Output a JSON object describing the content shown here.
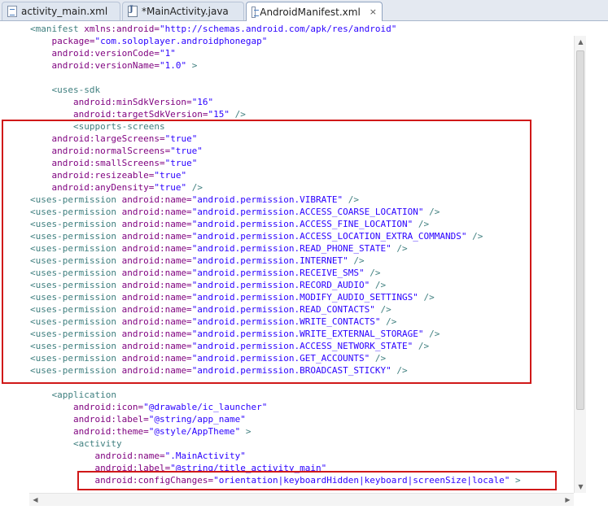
{
  "tabs": [
    {
      "label": "activity_main.xml",
      "icon": "xml-file-icon",
      "active": false
    },
    {
      "label": "*MainActivity.java",
      "icon": "java-file-icon",
      "active": false
    },
    {
      "label": "AndroidManifest.xml",
      "icon": "xml-file-icon",
      "active": true,
      "close": "×"
    }
  ],
  "code_lines": [
    [
      "<manifest",
      " xmlns:android=",
      "\"http://schemas.android.com/apk/res/android\""
    ],
    [
      "    package=",
      "\"com.soloplayer.androidphonegap\""
    ],
    [
      "    android:versionCode=",
      "\"1\""
    ],
    [
      "    android:versionName=",
      "\"1.0\"",
      " >"
    ],
    [
      ""
    ],
    [
      "    <uses-sdk"
    ],
    [
      "        android:minSdkVersion=",
      "\"16\""
    ],
    [
      "        android:targetSdkVersion=",
      "\"15\"",
      " />"
    ],
    [
      "        <supports-screens"
    ],
    [
      "    android:largeScreens=",
      "\"true\""
    ],
    [
      "    android:normalScreens=",
      "\"true\""
    ],
    [
      "    android:smallScreens=",
      "\"true\""
    ],
    [
      "    android:resizeable=",
      "\"true\""
    ],
    [
      "    android:anyDensity=",
      "\"true\"",
      " />"
    ],
    [
      "<uses-permission",
      " android:name=",
      "\"android.permission.VIBRATE\"",
      " />"
    ],
    [
      "<uses-permission",
      " android:name=",
      "\"android.permission.ACCESS_COARSE_LOCATION\"",
      " />"
    ],
    [
      "<uses-permission",
      " android:name=",
      "\"android.permission.ACCESS_FINE_LOCATION\"",
      " />"
    ],
    [
      "<uses-permission",
      " android:name=",
      "\"android.permission.ACCESS_LOCATION_EXTRA_COMMANDS\"",
      " />"
    ],
    [
      "<uses-permission",
      " android:name=",
      "\"android.permission.READ_PHONE_STATE\"",
      " />"
    ],
    [
      "<uses-permission",
      " android:name=",
      "\"android.permission.INTERNET\"",
      " />"
    ],
    [
      "<uses-permission",
      " android:name=",
      "\"android.permission.RECEIVE_SMS\"",
      " />"
    ],
    [
      "<uses-permission",
      " android:name=",
      "\"android.permission.RECORD_AUDIO\"",
      " />"
    ],
    [
      "<uses-permission",
      " android:name=",
      "\"android.permission.MODIFY_AUDIO_SETTINGS\"",
      " />"
    ],
    [
      "<uses-permission",
      " android:name=",
      "\"android.permission.READ_CONTACTS\"",
      " />"
    ],
    [
      "<uses-permission",
      " android:name=",
      "\"android.permission.WRITE_CONTACTS\"",
      " />"
    ],
    [
      "<uses-permission",
      " android:name=",
      "\"android.permission.WRITE_EXTERNAL_STORAGE\"",
      " />"
    ],
    [
      "<uses-permission",
      " android:name=",
      "\"android.permission.ACCESS_NETWORK_STATE\"",
      " />"
    ],
    [
      "<uses-permission",
      " android:name=",
      "\"android.permission.GET_ACCOUNTS\"",
      " />"
    ],
    [
      "<uses-permission",
      " android:name=",
      "\"android.permission.BROADCAST_STICKY\"",
      " />"
    ],
    [
      ""
    ],
    [
      "    <application"
    ],
    [
      "        android:icon=",
      "\"@drawable/ic_launcher\""
    ],
    [
      "        android:label=",
      "\"@string/app_name\""
    ],
    [
      "        android:theme=",
      "\"@style/AppTheme\"",
      " >"
    ],
    [
      "        <activity"
    ],
    [
      "            android:name=",
      "\".MainActivity\""
    ],
    [
      "            android:label=",
      "\"@string/title_activity_main\""
    ],
    [
      "            android:configChanges=",
      "\"orientation|keyboardHidden|keyboard|screenSize|locale\"",
      " >"
    ]
  ],
  "colors": {
    "highlight_box": "#d01818",
    "tag": "#3f7f7f",
    "attribute": "#7f007f",
    "value": "#2a00ff"
  },
  "scrollbar": {
    "up_arrow": "▲",
    "down_arrow": "▼",
    "left_arrow": "◀",
    "right_arrow": "▶"
  }
}
